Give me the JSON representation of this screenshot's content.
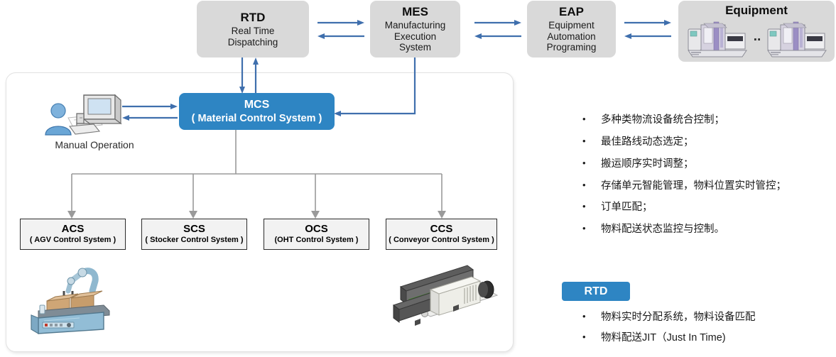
{
  "top_boxes": [
    {
      "title": "RTD",
      "subtitle_lines": [
        "Real  Time",
        "Dispatching"
      ]
    },
    {
      "title": "MES",
      "subtitle_lines": [
        "Manufacturing",
        "Execution",
        "System"
      ]
    },
    {
      "title": "EAP",
      "subtitle_lines": [
        "Equipment",
        "Automation",
        "Programing"
      ]
    },
    {
      "title": "Equipment",
      "subtitle_lines": []
    }
  ],
  "equipment": {
    "ellipsis": ".."
  },
  "mcs": {
    "title": "MCS",
    "subtitle": "( Material Control System )"
  },
  "manual_operation": {
    "label": "Manual Operation"
  },
  "control_systems": [
    {
      "title": "ACS",
      "subtitle": "( AGV Control System )"
    },
    {
      "title": "SCS",
      "subtitle": "( Stocker Control System )"
    },
    {
      "title": "OCS",
      "subtitle": "(OHT Control System )"
    },
    {
      "title": "CCS",
      "subtitle": "( Conveyor Control System )"
    }
  ],
  "bullets_primary": [
    "多种类物流设备统合控制；",
    "最佳路线动态选定；",
    "搬运顺序实时调整；",
    "存储单元智能管理，物料位置实时管控；",
    "订单匹配；",
    "物料配送状态监控与控制。"
  ],
  "rtd_badge": {
    "label": "RTD"
  },
  "bullets_rtd": [
    "物料实时分配系统，物料设备匹配",
    "物料配送JIT（Just In Time)"
  ],
  "bullet_marker": "•",
  "colors": {
    "accent_blue": "#2e85c3",
    "arrow_blue": "#3f6fad",
    "box_grey": "#d9d9d9",
    "tree_grey": "#9a9a9a",
    "cs_box_fill": "#f2f2f2"
  }
}
